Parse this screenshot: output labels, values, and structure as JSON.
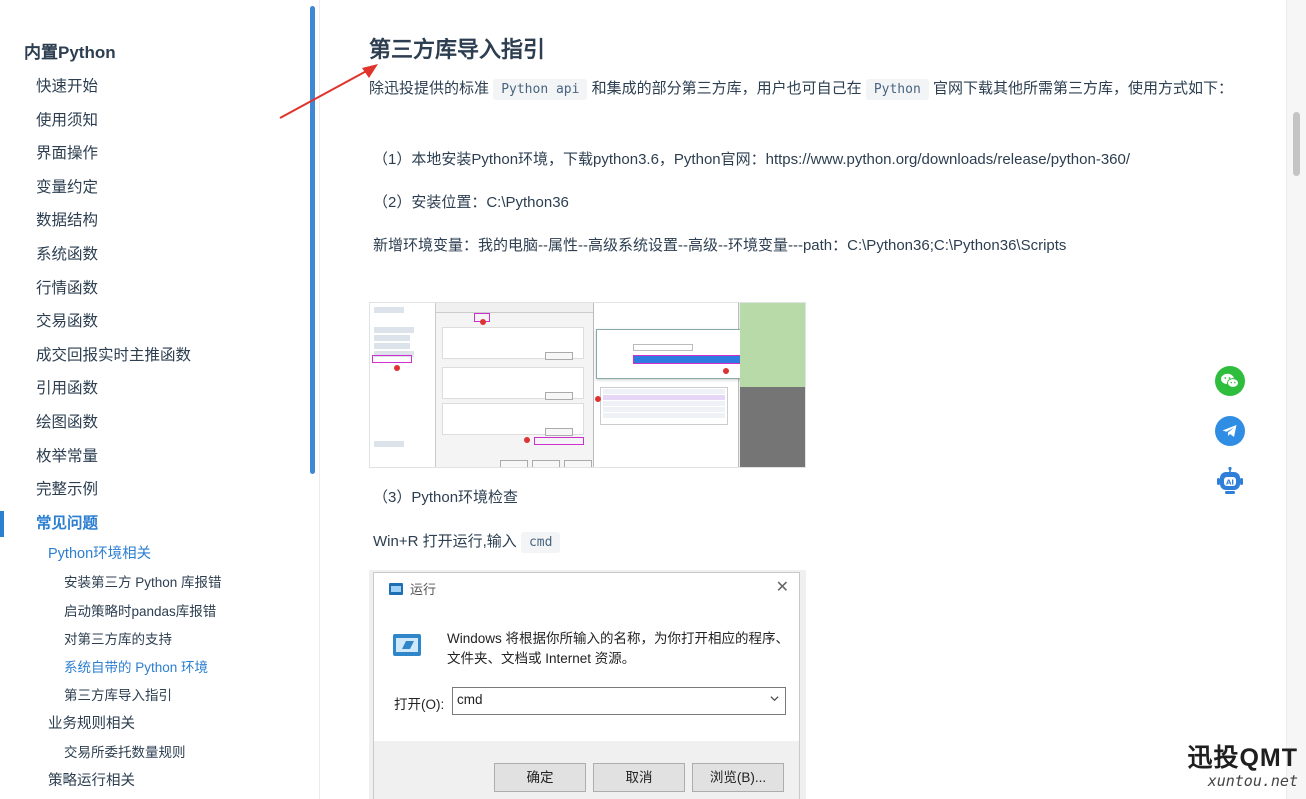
{
  "sidebar": {
    "group_title": "内置Python",
    "items": [
      {
        "label": "快速开始"
      },
      {
        "label": "使用须知"
      },
      {
        "label": "界面操作"
      },
      {
        "label": "变量约定"
      },
      {
        "label": "数据结构"
      },
      {
        "label": "系统函数"
      },
      {
        "label": "行情函数"
      },
      {
        "label": "交易函数"
      },
      {
        "label": "成交回报实时主推函数"
      },
      {
        "label": "引用函数"
      },
      {
        "label": "绘图函数"
      },
      {
        "label": "枚举常量"
      },
      {
        "label": "完整示例"
      },
      {
        "label": "常见问题"
      }
    ],
    "faq": {
      "section1": {
        "label": "Python环境相关",
        "items": [
          "安装第三方 Python 库报错",
          "启动策略时pandas库报错",
          "对第三方库的支持",
          "系统自带的 Python 环境",
          "第三方库导入指引"
        ]
      },
      "section2": {
        "label": "业务规则相关",
        "items": [
          "交易所委托数量规则"
        ]
      },
      "section3": {
        "label": "策略运行相关"
      }
    }
  },
  "main": {
    "title": "第三方库导入指引",
    "p1": {
      "before": "除迅投提供的标准",
      "code1": "Python api",
      "mid": "和集成的部分第三方库，用户也可自己在",
      "code2": "Python",
      "after": "官网下载其他所需第三方库，使用方式如下："
    },
    "step1": "（1）本地安装Python环境，下载python3.6，Python官网：https://www.python.org/downloads/release/python-360/",
    "step2": "（2）安装位置：C:\\Python36",
    "step2_env": "新增环境变量：我的电脑--属性--高级系统设置--高级--环境变量---path：C:\\Python36;C:\\Python36\\Scripts",
    "step3": "（3）Python环境检查",
    "run_line": {
      "text": "Win+R 打开运行,输入",
      "code": "cmd"
    },
    "run_dialog": {
      "title": "运行",
      "description": "Windows 将根据你所输入的名称，为你打开相应的程序、文件夹、文档或 Internet 资源。",
      "open_label": "打开(O):",
      "input_value": "cmd",
      "ok": "确定",
      "cancel": "取消",
      "browse": "浏览(B)..."
    }
  },
  "watermark": {
    "main": "迅投QMT",
    "sub": "xuntou.net"
  },
  "colors": {
    "accent": "#2c7fd1",
    "wechat": "#2ebd3c",
    "telegram": "#2f8de4",
    "arrow": "#e0332b"
  },
  "icons": [
    "wechat-icon",
    "telegram-icon",
    "ai-robot-icon"
  ]
}
